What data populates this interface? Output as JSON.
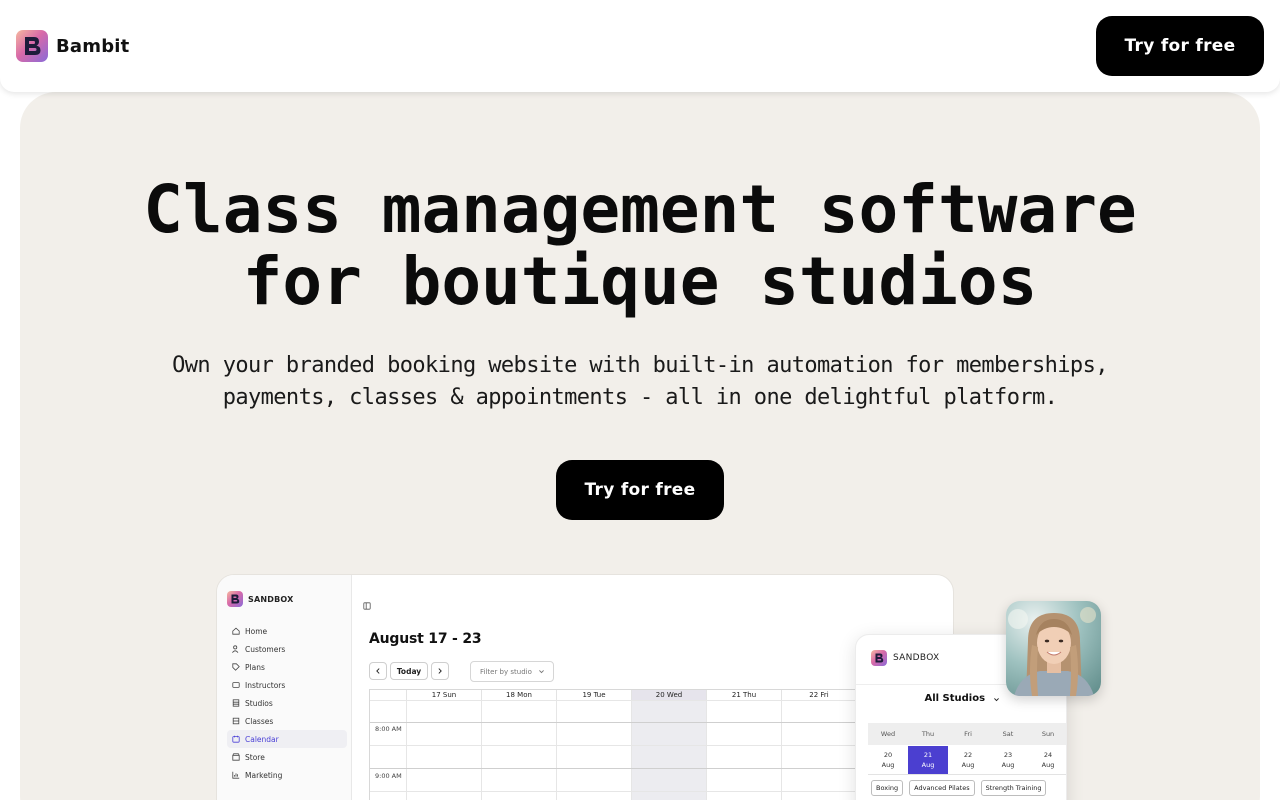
{
  "nav": {
    "brand": "Bambit",
    "cta": "Try for free"
  },
  "hero": {
    "title_line1": "Class management software",
    "title_line2": "for boutique studios",
    "subtitle_line1": "Own your branded booking website with built-in automation for memberships,",
    "subtitle_line2": "payments, classes & appointments - all in one delightful platform.",
    "cta": "Try for free"
  },
  "app": {
    "brand": "SANDBOX",
    "sidebar": {
      "items": [
        {
          "label": "Home",
          "icon": "home-icon"
        },
        {
          "label": "Customers",
          "icon": "users-icon"
        },
        {
          "label": "Plans",
          "icon": "tag-icon"
        },
        {
          "label": "Instructors",
          "icon": "id-card-icon"
        },
        {
          "label": "Studios",
          "icon": "building-icon"
        },
        {
          "label": "Classes",
          "icon": "layers-icon"
        },
        {
          "label": "Calendar",
          "icon": "calendar-icon",
          "active": true
        },
        {
          "label": "Store",
          "icon": "store-icon"
        },
        {
          "label": "Marketing",
          "icon": "chart-icon"
        }
      ]
    },
    "calendar": {
      "title": "August 17 - 23",
      "today_button": "Today",
      "filter_placeholder": "Filter by studio",
      "days": [
        "17 Sun",
        "18 Mon",
        "19 Tue",
        "20 Wed",
        "21 Thu",
        "22 Fri"
      ],
      "today_index": 3,
      "times": [
        "8:00 AM",
        "9:00 AM"
      ]
    }
  },
  "phone": {
    "brand": "SANDBOX",
    "studio_select": "All Studios",
    "weekdays": [
      "Wed",
      "Thu",
      "Fri",
      "Sat",
      "Sun"
    ],
    "dates": [
      {
        "day": "20",
        "month": "Aug"
      },
      {
        "day": "21",
        "month": "Aug",
        "selected": true
      },
      {
        "day": "22",
        "month": "Aug"
      },
      {
        "day": "23",
        "month": "Aug"
      },
      {
        "day": "24",
        "month": "Aug"
      }
    ],
    "class_tags": [
      "Boxing",
      "Advanced Pilates",
      "Strength Training"
    ]
  },
  "colors": {
    "accent": "#4b3fd0",
    "hero_bg": "#f2efea",
    "button_bg": "#000000"
  }
}
